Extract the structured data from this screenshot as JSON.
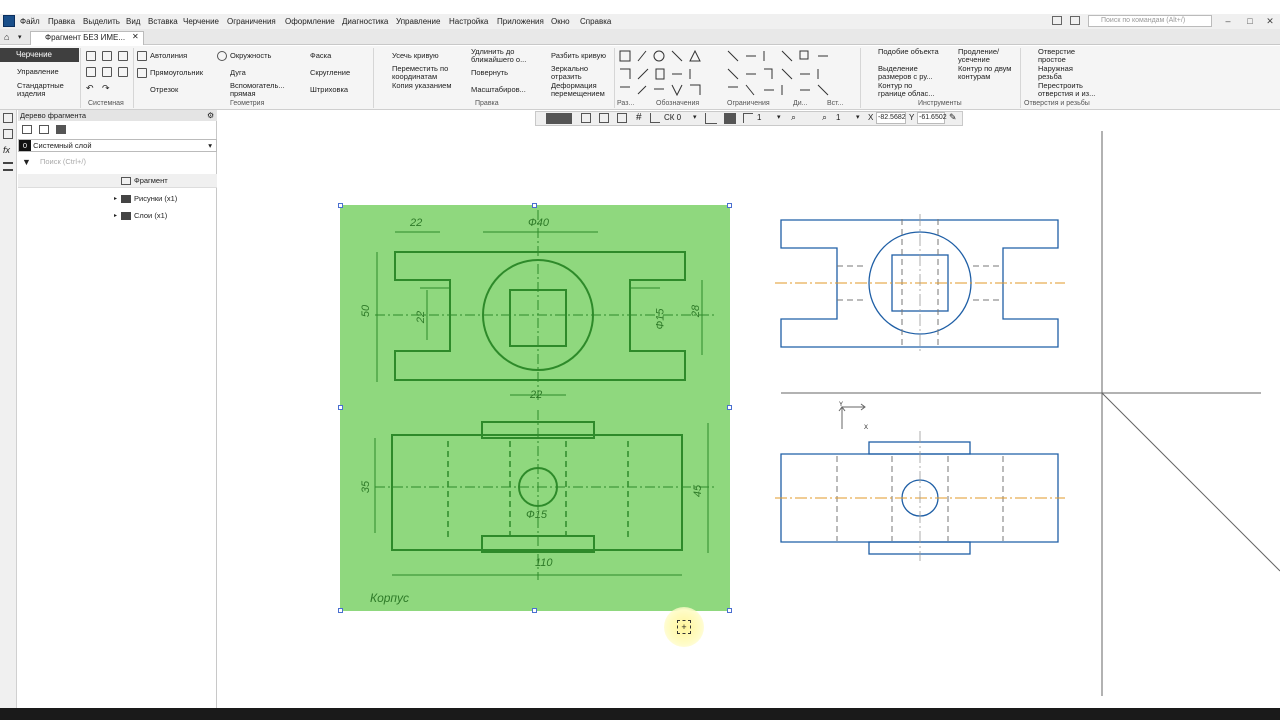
{
  "menu": {
    "items": [
      "Файл",
      "Правка",
      "Выделить",
      "Вид",
      "Вставка",
      "Черчение",
      "Ограничения",
      "Оформление",
      "Диагностика",
      "Управление",
      "Настройка",
      "Приложения",
      "Окно",
      "Справка"
    ],
    "search_placeholder": "Поиск по командам (Alt+/)"
  },
  "tab": {
    "title": "Фрагмент БЕЗ ИМЕ..."
  },
  "ribbon": {
    "left_nav": [
      "Черчение",
      "Управление",
      "Стандартные изделия"
    ],
    "groups": [
      "Системная",
      "Геометрия",
      "Правка",
      "Раз...",
      "Обозначения",
      "Ограничения",
      "Ди...",
      "Вст...",
      "Инструменты",
      "Отверстия и резьбы"
    ],
    "geometry": [
      "Автолиния",
      "Окружность",
      "Фаска",
      "Прямоугольник",
      "Дуга",
      "Скругление",
      "Отрезок",
      "Вспомогатель... прямая",
      "Штриховка"
    ],
    "edit": [
      "Усечь кривую",
      "Удлинить до ближайшего о...",
      "Разбить кривую",
      "Переместить по координатам",
      "Повернуть",
      "Зеркально отразить",
      "Копия указанием",
      "Масштабиров...",
      "Деформация перемещением"
    ],
    "tools": [
      "Подобие объекта",
      "Выделение размеров с ру...",
      "Контур по границе облас...",
      "Продление/ усечение",
      "Контур по двум контурам"
    ],
    "holes": [
      "Отверстие простое",
      "Наружная резьба",
      "Перестроить отверстия и из..."
    ]
  },
  "tree": {
    "header": "Дерево фрагмента",
    "layer_num": "0",
    "layer_name": "Системный слой",
    "search_placeholder": "Поиск (Ctrl+/)",
    "root": "Фрагмент",
    "items": [
      "Рисунки (x1)",
      "Слои (x1)"
    ]
  },
  "toolstrip": {
    "cs": "СК 0",
    "step": "1",
    "zoom": "1",
    "x_label": "X",
    "x_value": "-82.5682",
    "y_label": "Y",
    "y_value": "-61.6502"
  },
  "sketch": {
    "dims": [
      "22",
      "Ф40",
      "50",
      "22",
      "Ф15",
      "28",
      "22",
      "35",
      "Ф15",
      "45",
      "110"
    ],
    "caption": "Корпус"
  },
  "colors": {
    "accent": "#1a4f8a",
    "sketch_bg": "#8fd87e",
    "drawing": "#1f5fa6",
    "axis": "#e09a2a"
  }
}
